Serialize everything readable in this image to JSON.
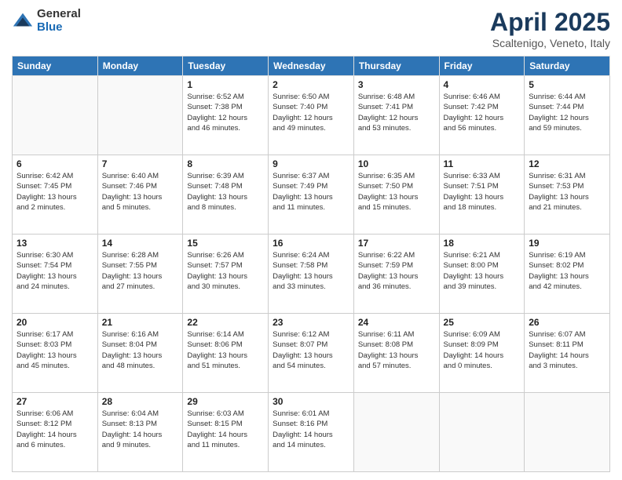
{
  "logo": {
    "general": "General",
    "blue": "Blue"
  },
  "header": {
    "month": "April 2025",
    "location": "Scaltenigo, Veneto, Italy"
  },
  "weekdays": [
    "Sunday",
    "Monday",
    "Tuesday",
    "Wednesday",
    "Thursday",
    "Friday",
    "Saturday"
  ],
  "weeks": [
    [
      {
        "day": "",
        "info": ""
      },
      {
        "day": "",
        "info": ""
      },
      {
        "day": "1",
        "info": "Sunrise: 6:52 AM\nSunset: 7:38 PM\nDaylight: 12 hours\nand 46 minutes."
      },
      {
        "day": "2",
        "info": "Sunrise: 6:50 AM\nSunset: 7:40 PM\nDaylight: 12 hours\nand 49 minutes."
      },
      {
        "day": "3",
        "info": "Sunrise: 6:48 AM\nSunset: 7:41 PM\nDaylight: 12 hours\nand 53 minutes."
      },
      {
        "day": "4",
        "info": "Sunrise: 6:46 AM\nSunset: 7:42 PM\nDaylight: 12 hours\nand 56 minutes."
      },
      {
        "day": "5",
        "info": "Sunrise: 6:44 AM\nSunset: 7:44 PM\nDaylight: 12 hours\nand 59 minutes."
      }
    ],
    [
      {
        "day": "6",
        "info": "Sunrise: 6:42 AM\nSunset: 7:45 PM\nDaylight: 13 hours\nand 2 minutes."
      },
      {
        "day": "7",
        "info": "Sunrise: 6:40 AM\nSunset: 7:46 PM\nDaylight: 13 hours\nand 5 minutes."
      },
      {
        "day": "8",
        "info": "Sunrise: 6:39 AM\nSunset: 7:48 PM\nDaylight: 13 hours\nand 8 minutes."
      },
      {
        "day": "9",
        "info": "Sunrise: 6:37 AM\nSunset: 7:49 PM\nDaylight: 13 hours\nand 11 minutes."
      },
      {
        "day": "10",
        "info": "Sunrise: 6:35 AM\nSunset: 7:50 PM\nDaylight: 13 hours\nand 15 minutes."
      },
      {
        "day": "11",
        "info": "Sunrise: 6:33 AM\nSunset: 7:51 PM\nDaylight: 13 hours\nand 18 minutes."
      },
      {
        "day": "12",
        "info": "Sunrise: 6:31 AM\nSunset: 7:53 PM\nDaylight: 13 hours\nand 21 minutes."
      }
    ],
    [
      {
        "day": "13",
        "info": "Sunrise: 6:30 AM\nSunset: 7:54 PM\nDaylight: 13 hours\nand 24 minutes."
      },
      {
        "day": "14",
        "info": "Sunrise: 6:28 AM\nSunset: 7:55 PM\nDaylight: 13 hours\nand 27 minutes."
      },
      {
        "day": "15",
        "info": "Sunrise: 6:26 AM\nSunset: 7:57 PM\nDaylight: 13 hours\nand 30 minutes."
      },
      {
        "day": "16",
        "info": "Sunrise: 6:24 AM\nSunset: 7:58 PM\nDaylight: 13 hours\nand 33 minutes."
      },
      {
        "day": "17",
        "info": "Sunrise: 6:22 AM\nSunset: 7:59 PM\nDaylight: 13 hours\nand 36 minutes."
      },
      {
        "day": "18",
        "info": "Sunrise: 6:21 AM\nSunset: 8:00 PM\nDaylight: 13 hours\nand 39 minutes."
      },
      {
        "day": "19",
        "info": "Sunrise: 6:19 AM\nSunset: 8:02 PM\nDaylight: 13 hours\nand 42 minutes."
      }
    ],
    [
      {
        "day": "20",
        "info": "Sunrise: 6:17 AM\nSunset: 8:03 PM\nDaylight: 13 hours\nand 45 minutes."
      },
      {
        "day": "21",
        "info": "Sunrise: 6:16 AM\nSunset: 8:04 PM\nDaylight: 13 hours\nand 48 minutes."
      },
      {
        "day": "22",
        "info": "Sunrise: 6:14 AM\nSunset: 8:06 PM\nDaylight: 13 hours\nand 51 minutes."
      },
      {
        "day": "23",
        "info": "Sunrise: 6:12 AM\nSunset: 8:07 PM\nDaylight: 13 hours\nand 54 minutes."
      },
      {
        "day": "24",
        "info": "Sunrise: 6:11 AM\nSunset: 8:08 PM\nDaylight: 13 hours\nand 57 minutes."
      },
      {
        "day": "25",
        "info": "Sunrise: 6:09 AM\nSunset: 8:09 PM\nDaylight: 14 hours\nand 0 minutes."
      },
      {
        "day": "26",
        "info": "Sunrise: 6:07 AM\nSunset: 8:11 PM\nDaylight: 14 hours\nand 3 minutes."
      }
    ],
    [
      {
        "day": "27",
        "info": "Sunrise: 6:06 AM\nSunset: 8:12 PM\nDaylight: 14 hours\nand 6 minutes."
      },
      {
        "day": "28",
        "info": "Sunrise: 6:04 AM\nSunset: 8:13 PM\nDaylight: 14 hours\nand 9 minutes."
      },
      {
        "day": "29",
        "info": "Sunrise: 6:03 AM\nSunset: 8:15 PM\nDaylight: 14 hours\nand 11 minutes."
      },
      {
        "day": "30",
        "info": "Sunrise: 6:01 AM\nSunset: 8:16 PM\nDaylight: 14 hours\nand 14 minutes."
      },
      {
        "day": "",
        "info": ""
      },
      {
        "day": "",
        "info": ""
      },
      {
        "day": "",
        "info": ""
      }
    ]
  ]
}
